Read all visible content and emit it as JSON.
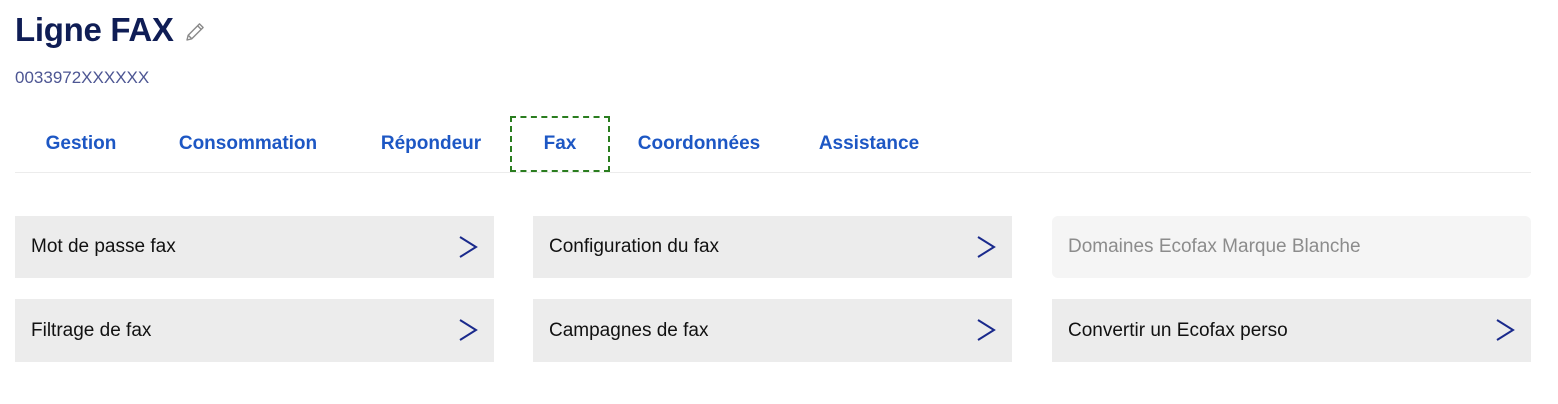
{
  "header": {
    "title": "Ligne FAX",
    "subtitle": "0033972XXXXXX",
    "edit_icon": "pencil-icon"
  },
  "tabs": [
    {
      "label": "Gestion",
      "active": false
    },
    {
      "label": "Consommation",
      "active": false
    },
    {
      "label": "Répondeur",
      "active": false
    },
    {
      "label": "Fax",
      "active": true
    },
    {
      "label": "Coordonnées",
      "active": false
    },
    {
      "label": "Assistance",
      "active": false
    }
  ],
  "tiles": [
    {
      "label": "Mot de passe fax",
      "enabled": true,
      "icon": "chevron-right-icon"
    },
    {
      "label": "Configuration du fax",
      "enabled": true,
      "icon": "chevron-right-icon"
    },
    {
      "label": "Domaines Ecofax Marque Blanche",
      "enabled": false
    },
    {
      "label": "Filtrage de fax",
      "enabled": true,
      "icon": "chevron-right-icon"
    },
    {
      "label": "Campagnes de fax",
      "enabled": true,
      "icon": "chevron-right-icon"
    },
    {
      "label": "Convertir un Ecofax perso",
      "enabled": true,
      "icon": "chevron-right-icon"
    }
  ],
  "colors": {
    "title": "#0f1d55",
    "tab_text": "#1d57c4",
    "active_tab_outline": "#2a7d1f",
    "tile_background": "#ececec",
    "chevron": "#1a2a8c"
  }
}
